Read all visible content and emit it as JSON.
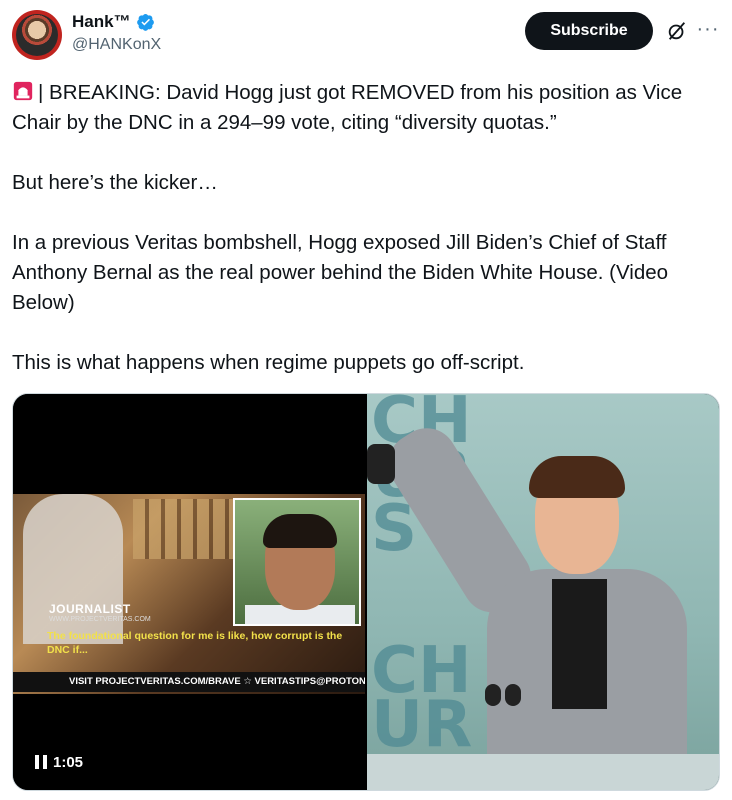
{
  "author": {
    "display_name": "Hank™",
    "handle": "@HANKonX",
    "verified_icon": "verified-badge-icon",
    "avatar_icon": "avatar-photo"
  },
  "actions": {
    "subscribe_label": "Subscribe",
    "grok_icon": "grok-icon",
    "more_icon": "more-options-icon"
  },
  "tweet": {
    "line1_emoji": "police-siren-icon",
    "paragraph1": "| BREAKING: David Hogg just got REMOVED from his position as Vice Chair by the DNC in a 294–99 vote, citing “diversity quotas.”",
    "paragraph2": "But here’s the kicker…",
    "paragraph3": "In a previous Veritas bombshell, Hogg exposed Jill Biden’s Chief of Staff Anthony Bernal as the real power behind the Biden White House. (Video Below)",
    "paragraph4": "This is what happens when regime puppets go off-script."
  },
  "media": {
    "video": {
      "lower_third_label": "JOURNALIST",
      "lower_third_site": "WWW.PROJECTVERITAS.COM",
      "subtitle": "The foundational question for me is like, how corrupt is the DNC if...",
      "ticker": "VISIT PROJECTVERITAS.COM/BRAVE ☆ VERITASTIPS@PROTONMAIL.COM",
      "timestamp": "1:05",
      "control_icon": "pause-icon"
    },
    "photo": {
      "background_text_top": "CH\nUR\nS",
      "background_text_bottom": "CH\nUR"
    }
  },
  "colors": {
    "subscribe_bg": "#0f1419",
    "verified": "#1d9bf0",
    "secondary_text": "#536471",
    "subtitle_yellow": "#f2e14a"
  }
}
